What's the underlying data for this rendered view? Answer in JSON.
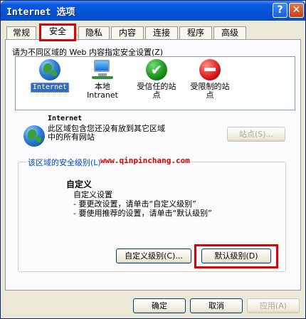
{
  "window": {
    "title": "Internet 选项",
    "help_glyph": "?",
    "close_glyph": "✕"
  },
  "tabs": [
    {
      "label": "常规"
    },
    {
      "label": "安全"
    },
    {
      "label": "隐私"
    },
    {
      "label": "内容"
    },
    {
      "label": "连接"
    },
    {
      "label": "程序"
    },
    {
      "label": "高级"
    }
  ],
  "active_tab": 1,
  "zones_label": "请为不同区域的 Web 内容指定安全设置(Z)",
  "zones": [
    {
      "label": "Internet",
      "icon": "globe-icon"
    },
    {
      "label": "本地\nIntranet",
      "icon": "local-intranet-icon"
    },
    {
      "label": "受信任的站\n点",
      "icon": "trusted-sites-icon"
    },
    {
      "label": "受限制的站\n点",
      "icon": "restricted-sites-icon"
    }
  ],
  "selected_zone": {
    "title": "Internet",
    "description": "此区域包含您还没有放到其它区域\n中的所有网站",
    "sites_button": "站点(S)..."
  },
  "security_level": {
    "legend": "该区域的安全级别(L)",
    "watermark": "www.qinpinchang.com",
    "level_name": "自定义",
    "lines": [
      "自定义设置",
      "- 要更改设置，请单击“自定义级别”",
      "- 要使用推荐的设置，请单击“默认级别”"
    ],
    "custom_level_button": "自定义级别(C)...",
    "default_level_button": "默认级别(D)"
  },
  "footer": {
    "ok": "确定",
    "cancel": "取消",
    "apply": "应用(A)"
  },
  "colors": {
    "highlight_red": "#e00000",
    "selection_blue": "#316ac5",
    "titlebar_blue": "#0354d8"
  }
}
